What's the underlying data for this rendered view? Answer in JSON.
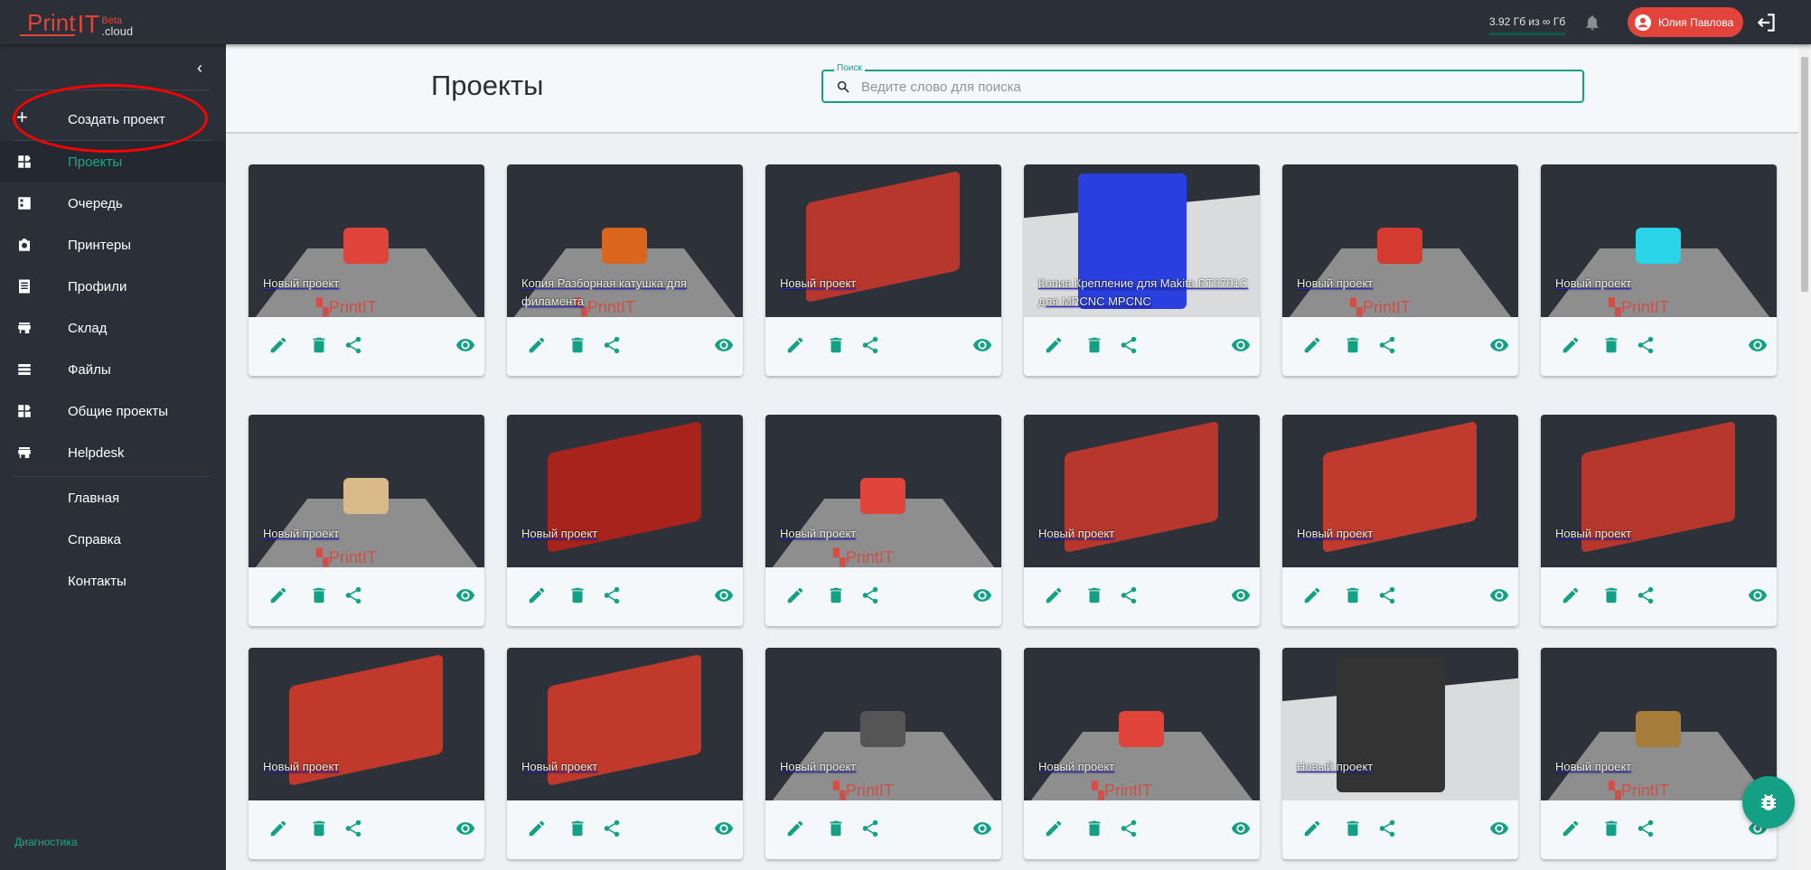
{
  "topbar": {
    "logo_print": "Print",
    "logo_it": "IT",
    "logo_beta": "Beta",
    "logo_cloud": ".cloud",
    "storage": "3.92 Гб из ∞ Гб",
    "user_name": "Юлия Павлова"
  },
  "sidebar": {
    "create": "Создать проект",
    "items": [
      {
        "label": "Проекты",
        "icon": "dashboard-icon",
        "active": true
      },
      {
        "label": "Очередь",
        "icon": "queue-icon"
      },
      {
        "label": "Принтеры",
        "icon": "printer-icon"
      },
      {
        "label": "Профили",
        "icon": "profile-icon"
      },
      {
        "label": "Склад",
        "icon": "store-icon"
      },
      {
        "label": "Файлы",
        "icon": "files-icon"
      },
      {
        "label": "Общие проекты",
        "icon": "dashboard-icon"
      },
      {
        "label": "Helpdesk",
        "icon": "store-icon"
      }
    ],
    "links": [
      "Главная",
      "Справка",
      "Контакты"
    ],
    "diagnostics": "Диагностика"
  },
  "header": {
    "title": "Проекты",
    "search_label": "Поиск",
    "search_placeholder": "Ведите слово для поиска",
    "search_value": ""
  },
  "accent": "#14a085",
  "projects": [
    {
      "title": "Новый проект",
      "model": "#e0443a",
      "view": "plate"
    },
    {
      "title": "Копия Разборная катушка для филамента",
      "model": "#d9661c",
      "view": "plate"
    },
    {
      "title": "Новый проект",
      "model": "#b8372c",
      "view": "dark"
    },
    {
      "title": "Копия Крепление для Makita RT0701C для MPCNC MPCNC",
      "model": "#2a3fe0",
      "view": "light"
    },
    {
      "title": "Новый проект",
      "model": "#d43a30",
      "view": "plate"
    },
    {
      "title": "Новый проект",
      "model": "#2ad4e8",
      "view": "plate"
    },
    {
      "title": "Новый проект",
      "model": "#d9b98a",
      "view": "plate"
    },
    {
      "title": "Новый проект",
      "model": "#a8231c",
      "view": "dark"
    },
    {
      "title": "Новый проект",
      "model": "#e0443a",
      "view": "plate"
    },
    {
      "title": "Новый проект",
      "model": "#b8372c",
      "view": "dark"
    },
    {
      "title": "Новый проект",
      "model": "#c03a2e",
      "view": "dark"
    },
    {
      "title": "Новый проект",
      "model": "#b8372c",
      "view": "dark"
    },
    {
      "title": "Новый проект",
      "model": "#c0392b",
      "view": "dark"
    },
    {
      "title": "Новый проект",
      "model": "#c0392b",
      "view": "dark"
    },
    {
      "title": "Новый проект",
      "model": "#555555",
      "view": "plate"
    },
    {
      "title": "Новый проект",
      "model": "#e0443a",
      "view": "plate"
    },
    {
      "title": "Новый проект",
      "model": "#333333",
      "view": "light"
    },
    {
      "title": "Новый проект",
      "model": "#a67c3a",
      "view": "plate"
    }
  ]
}
